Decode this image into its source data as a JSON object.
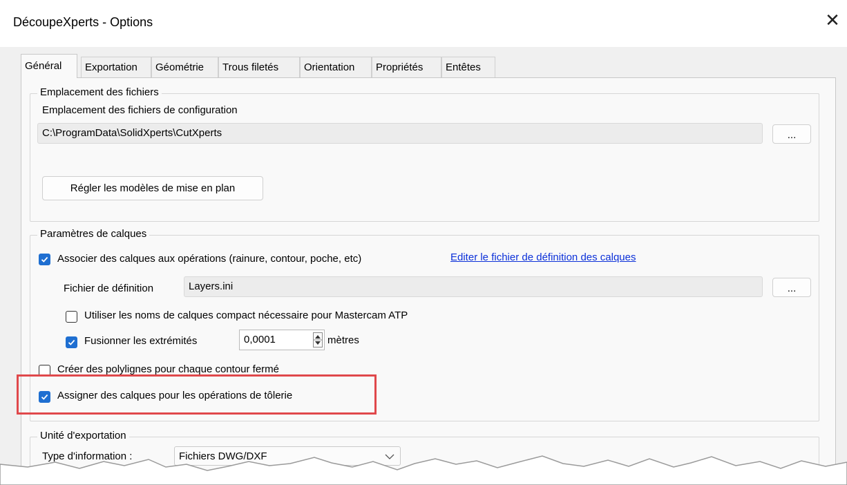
{
  "window": {
    "title": "DécoupeXperts - Options"
  },
  "tabs": [
    {
      "label": "Général"
    },
    {
      "label": "Exportation"
    },
    {
      "label": "Géométrie"
    },
    {
      "label": "Trous filetés"
    },
    {
      "label": "Orientation"
    },
    {
      "label": "Propriétés"
    },
    {
      "label": "Entêtes"
    }
  ],
  "files_group": {
    "legend": "Emplacement des fichiers",
    "config_label": "Emplacement des fichiers de configuration",
    "config_path": "C:\\ProgramData\\SolidXperts\\CutXperts",
    "browse_label": "...",
    "drawing_templates_button": "Régler les modèles de mise en plan"
  },
  "layers_group": {
    "legend": "Paramètres de calques",
    "associate_layers": {
      "label": "Associer des calques aux opérations (rainure, contour, poche, etc)",
      "checked": true
    },
    "edit_link": "Editer le fichier de définition des calques",
    "definition_label": "Fichier de définition",
    "definition_value": "Layers.ini",
    "browse_label": "...",
    "compact_names": {
      "label": "Utiliser les noms de calques compact nécessaire pour Mastercam ATP",
      "checked": false
    },
    "merge_ends": {
      "label": "Fusionner les extrémités",
      "checked": true
    },
    "merge_value": "0,0001",
    "merge_unit": "mètres",
    "polylines": {
      "label": "Créer des polylignes pour chaque contour fermé",
      "checked": false
    },
    "sheet_metal": {
      "label": "Assigner des calques pour les opérations de tôlerie",
      "checked": true
    }
  },
  "export_group": {
    "legend": "Unité d'exportation",
    "type_label": "Type d'information :",
    "type_value": "Fichiers DWG/DXF"
  },
  "colors": {
    "highlight": "#e0484b",
    "checkbox": "#1f6fd1",
    "link": "#0b30d9"
  }
}
